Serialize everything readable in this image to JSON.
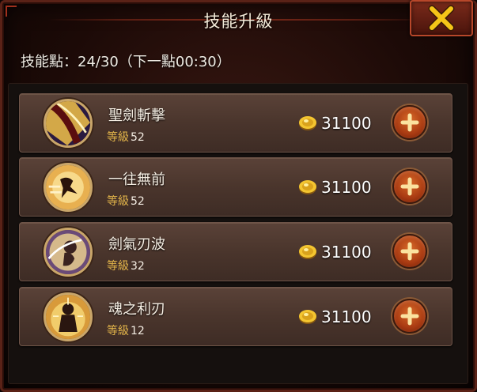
{
  "header": {
    "title": "技能升級",
    "close_icon": "close-x-icon"
  },
  "skill_points": {
    "label": "技能點：24/30（下一點00:30）",
    "current": 24,
    "max": 30,
    "next_timer": "00:30"
  },
  "skills": [
    {
      "name": "聖劍斬擊",
      "level_label": "等級",
      "level": "52",
      "cost": "31100",
      "icon": "sword-slash-icon"
    },
    {
      "name": "一往無前",
      "level_label": "等級",
      "level": "52",
      "cost": "31100",
      "icon": "charge-icon"
    },
    {
      "name": "劍氣刃波",
      "level_label": "等級",
      "level": "32",
      "cost": "31100",
      "icon": "blade-wave-icon"
    },
    {
      "name": "魂之利刃",
      "level_label": "等級",
      "level": "12",
      "cost": "31100",
      "icon": "soul-blade-icon"
    }
  ],
  "colors": {
    "accent_gold": "#e3b54a",
    "close_x": "#f5c518",
    "plus_button": "#c0501a"
  }
}
